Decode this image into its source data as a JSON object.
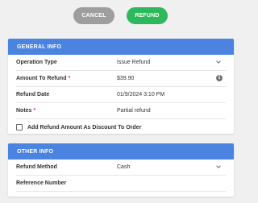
{
  "actions": {
    "cancel_label": "CANCEL",
    "refund_label": "REFUND"
  },
  "general": {
    "header": "GENERAL INFO",
    "operation_type": {
      "label": "Operation Type",
      "value": "Issue Refund"
    },
    "amount": {
      "label": "Amount To Refund",
      "required": "*",
      "value": "$39.90"
    },
    "refund_date": {
      "label": "Refund Date",
      "value": "01/9/2024 3:10 PM"
    },
    "notes": {
      "label": "Notes",
      "required": "*",
      "value": "Partial refund"
    },
    "discount_checkbox": {
      "label": "Add Refund Amount As Discount To Order",
      "checked": false
    }
  },
  "other": {
    "header": "OTHER INFO",
    "refund_method": {
      "label": "Refund Method",
      "value": "Cash"
    },
    "reference_number": {
      "label": "Reference Number",
      "value": ""
    }
  },
  "icons": {
    "dropdown": "chevron-down-icon",
    "info": "info-icon"
  },
  "colors": {
    "header_blue": "#4a84e0",
    "refund_green": "#2eb85c",
    "cancel_gray": "#9e9e9e",
    "required_red": "#e53935"
  }
}
